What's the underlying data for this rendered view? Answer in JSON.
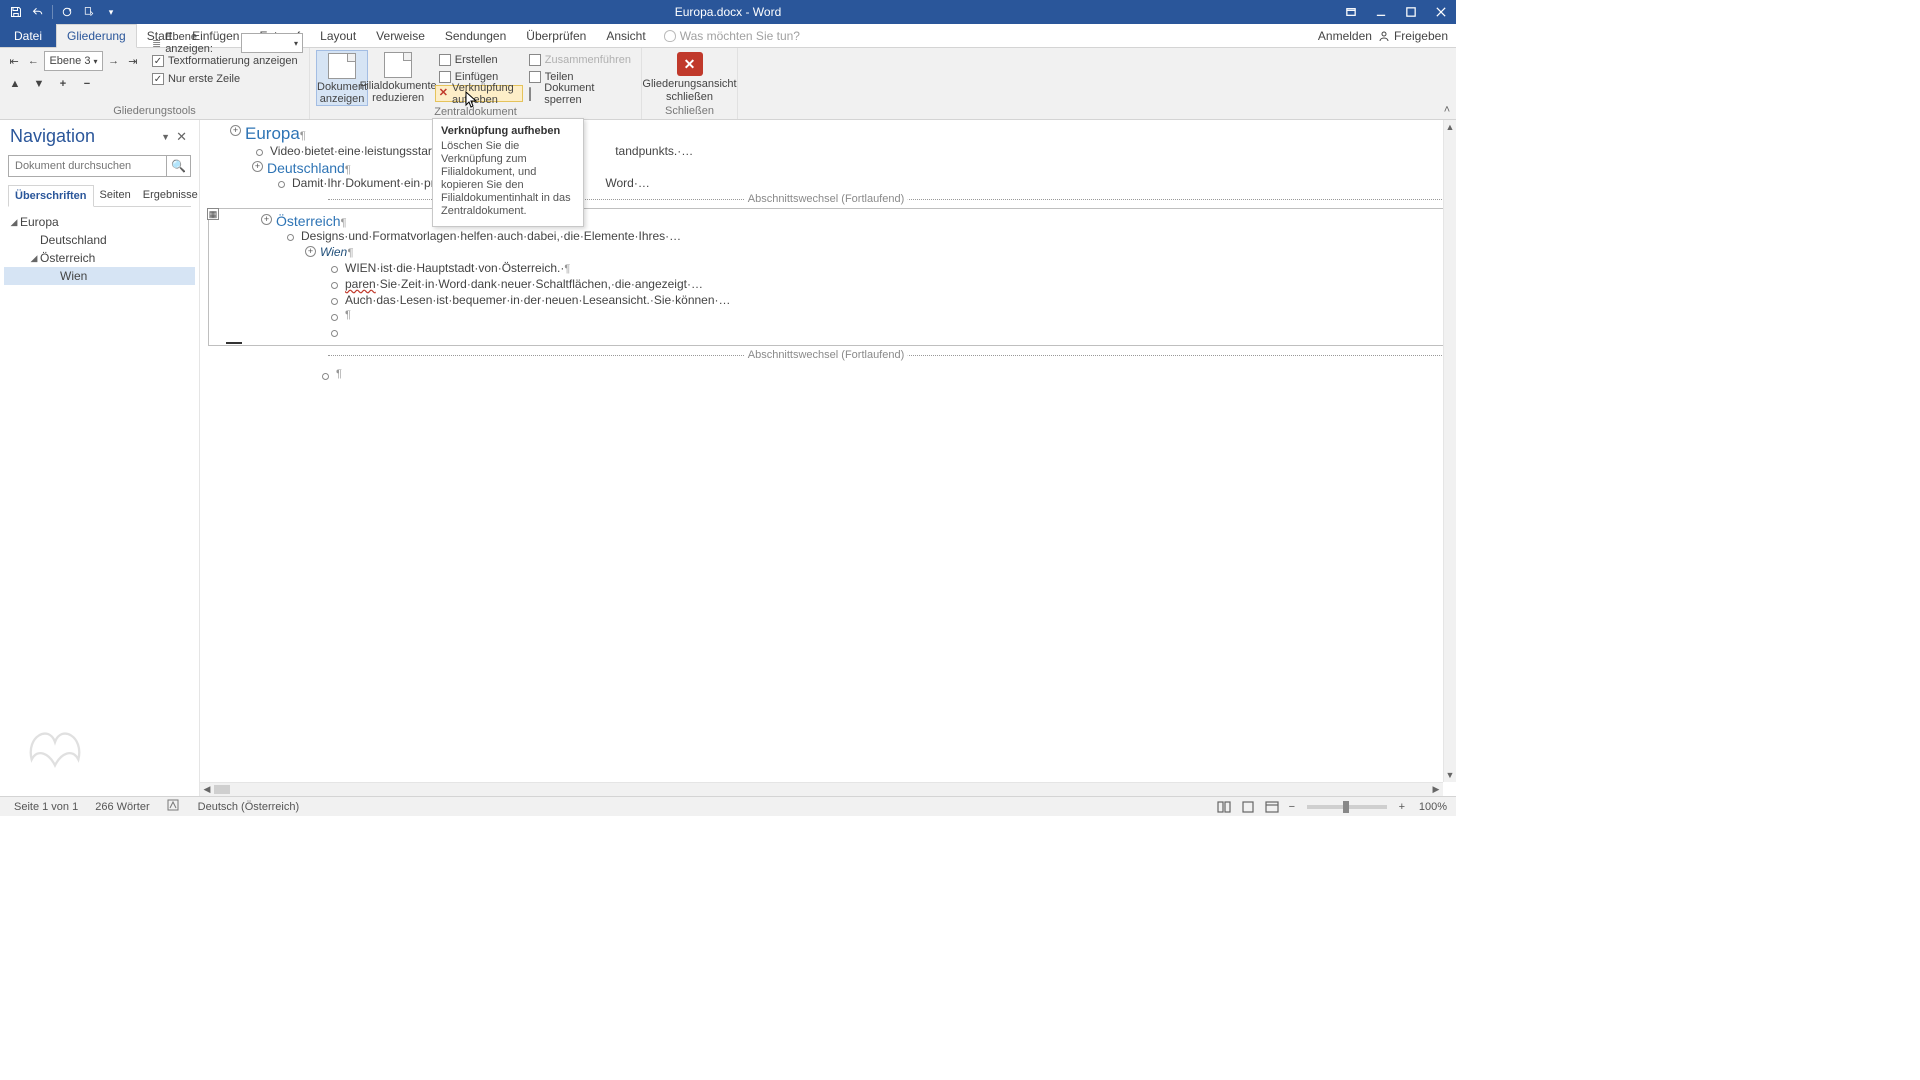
{
  "title": "Europa.docx - Word",
  "qat": {
    "save": "save",
    "undo": "undo",
    "redo": "redo",
    "mode": "mode",
    "more": "more"
  },
  "tabs": {
    "file": "Datei",
    "items": [
      "Gliederung",
      "Start",
      "Einfügen",
      "Entwurf",
      "Layout",
      "Verweise",
      "Sendungen",
      "Überprüfen",
      "Ansicht"
    ],
    "active": 0,
    "tellme_placeholder": "Was möchten Sie tun?",
    "signin": "Anmelden",
    "share": "Freigeben"
  },
  "ribbon": {
    "outline": {
      "level_value": "Ebene 3",
      "show_level_label": "Ebene anzeigen:",
      "show_level_value": "",
      "chk_textfmt": "Textformatierung anzeigen",
      "chk_firstline": "Nur erste Zeile",
      "group_label": "Gliederungstools"
    },
    "master": {
      "show_doc_l1": "Dokument",
      "show_doc_l2": "anzeigen",
      "collapse_l1": "Filialdokumente",
      "collapse_l2": "reduzieren",
      "create": "Erstellen",
      "insert": "Einfügen",
      "unlink": "Verknüpfung aufheben",
      "merge": "Zusammenführen",
      "split": "Teilen",
      "lock": "Dokument sperren",
      "group_label": "Zentraldokument"
    },
    "close": {
      "l1": "Gliederungsansicht",
      "l2": "schließen",
      "group_label": "Schließen"
    }
  },
  "tooltip": {
    "title": "Verknüpfung aufheben",
    "body": "Löschen Sie die Verknüpfung zum Filialdokument, und kopieren Sie den Filialdokumentinhalt in das Zentraldokument."
  },
  "nav": {
    "title": "Navigation",
    "search_placeholder": "Dokument durchsuchen",
    "tabs": [
      "Überschriften",
      "Seiten",
      "Ergebnisse"
    ],
    "tree": [
      {
        "level": 0,
        "label": "Europa",
        "open": true
      },
      {
        "level": 1,
        "label": "Deutschland",
        "open": false
      },
      {
        "level": 1,
        "label": "Österreich",
        "open": true
      },
      {
        "level": 2,
        "label": "Wien",
        "selected": true
      }
    ]
  },
  "doc": {
    "l_europa": "Europa",
    "l_video": "Video·bietet·eine·leistungsstarke·Mö",
    "l_video_tail": "tandpunkts.·…",
    "l_deutsch": "Deutschland",
    "l_damit": "Damit·Ihr·Dokument·ein·profe",
    "l_damit_tail": "Word·…",
    "l_secbreak": "Abschnittswechsel (Fortlaufend)",
    "l_oest": "Österreich",
    "l_designs": "Designs·und·Formatvorlagen·helfen·auch·dabei,·die·Elemente·Ihres·…",
    "l_wien": "Wien",
    "l_wien1": "WIEN·ist·die·Hauptstadt·von·Österreich.·",
    "l_wien2a": "paren",
    "l_wien2b": "·Sie·Zeit·in·Word·dank·neuer·Schaltflächen,·die·angezeigt·…",
    "l_wien3": "Auch·das·Lesen·ist·bequemer·in·der·neuen·Leseansicht.·Sie·können·…",
    "pilcrow": "¶"
  },
  "status": {
    "page": "Seite 1 von 1",
    "words": "266 Wörter",
    "lang": "Deutsch (Österreich)",
    "zoom": "100%"
  }
}
